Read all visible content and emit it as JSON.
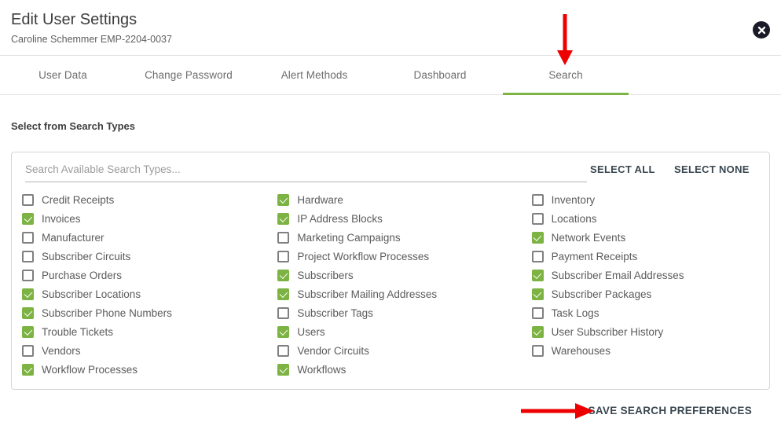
{
  "header": {
    "title": "Edit User Settings",
    "subtitle": "Caroline Schemmer EMP-2204-0037",
    "close_icon": "close-circle-icon"
  },
  "tabs": [
    {
      "label": "User Data",
      "active": false
    },
    {
      "label": "Change Password",
      "active": false
    },
    {
      "label": "Alert Methods",
      "active": false
    },
    {
      "label": "Dashboard",
      "active": false
    },
    {
      "label": "Search",
      "active": true
    }
  ],
  "section": {
    "label": "Select from Search Types"
  },
  "search": {
    "value": "",
    "placeholder": "Search Available Search Types...",
    "select_all_label": "SELECT ALL",
    "select_none_label": "SELECT NONE"
  },
  "columns": [
    {
      "items": [
        {
          "label": "Credit Receipts",
          "checked": false
        },
        {
          "label": "Invoices",
          "checked": true
        },
        {
          "label": "Manufacturer",
          "checked": false
        },
        {
          "label": "Subscriber Circuits",
          "checked": false
        },
        {
          "label": "Purchase Orders",
          "checked": false
        },
        {
          "label": "Subscriber Locations",
          "checked": true
        },
        {
          "label": "Subscriber Phone Numbers",
          "checked": true
        },
        {
          "label": "Trouble Tickets",
          "checked": true
        },
        {
          "label": "Vendors",
          "checked": false
        },
        {
          "label": "Workflow Processes",
          "checked": true
        }
      ]
    },
    {
      "items": [
        {
          "label": "Hardware",
          "checked": true
        },
        {
          "label": "IP Address Blocks",
          "checked": true
        },
        {
          "label": "Marketing Campaigns",
          "checked": false
        },
        {
          "label": "Project Workflow Processes",
          "checked": false
        },
        {
          "label": "Subscribers",
          "checked": true
        },
        {
          "label": "Subscriber Mailing Addresses",
          "checked": true
        },
        {
          "label": "Subscriber Tags",
          "checked": false
        },
        {
          "label": "Users",
          "checked": true
        },
        {
          "label": "Vendor Circuits",
          "checked": false
        },
        {
          "label": "Workflows",
          "checked": true
        }
      ]
    },
    {
      "items": [
        {
          "label": "Inventory",
          "checked": false
        },
        {
          "label": "Locations",
          "checked": false
        },
        {
          "label": "Network Events",
          "checked": true
        },
        {
          "label": "Payment Receipts",
          "checked": false
        },
        {
          "label": "Subscriber Email Addresses",
          "checked": true
        },
        {
          "label": "Subscriber Packages",
          "checked": true
        },
        {
          "label": "Task Logs",
          "checked": false
        },
        {
          "label": "User Subscriber History",
          "checked": true
        },
        {
          "label": "Warehouses",
          "checked": false
        }
      ]
    }
  ],
  "footer": {
    "save_label": "SAVE SEARCH PREFERENCES"
  },
  "annotations": [
    {
      "name": "arrow-to-search-tab",
      "direction": "down",
      "color": "#ee0000"
    },
    {
      "name": "arrow-to-save-button",
      "direction": "right",
      "color": "#ee0000"
    }
  ],
  "colors": {
    "accent_green": "#7cb342",
    "annotation_red": "#ee0000",
    "action_text": "#3a4750"
  }
}
